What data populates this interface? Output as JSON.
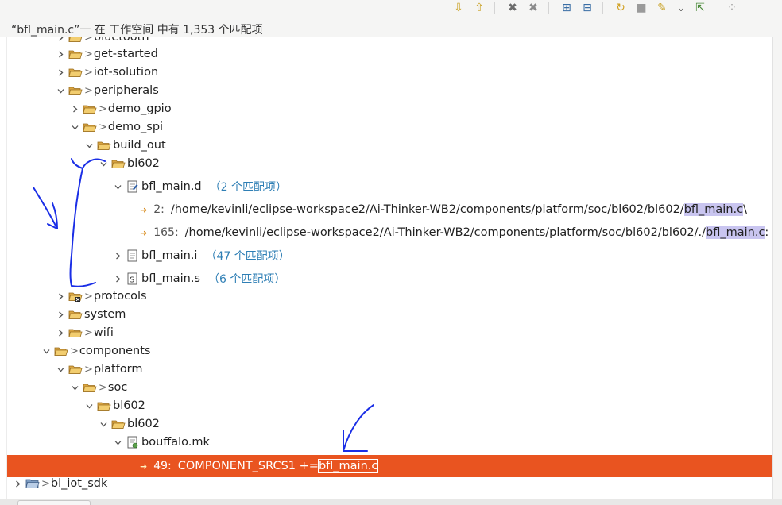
{
  "toolbar": {
    "buttons": [
      {
        "name": "show-next-match-button",
        "glyph": "⇩",
        "color": "#c9a227"
      },
      {
        "name": "show-previous-match-button",
        "glyph": "⇧",
        "color": "#c9a227"
      },
      {
        "name": "remove-selected-matches-button",
        "glyph": "✖",
        "color": "#6b6b6b"
      },
      {
        "name": "remove-all-matches-button",
        "glyph": "✖",
        "color": "#8a8a8a"
      },
      {
        "name": "expand-all-button",
        "glyph": "⊞",
        "color": "#3a6ea5"
      },
      {
        "name": "collapse-all-button",
        "glyph": "⊟",
        "color": "#3a6ea5"
      },
      {
        "name": "run-current-search-again-button",
        "glyph": "↻",
        "color": "#d1a020"
      },
      {
        "name": "cancel-current-search-button",
        "glyph": "■",
        "color": "#9a9a9a"
      },
      {
        "name": "show-previous-searches-button",
        "glyph": "✎",
        "color": "#c9a227"
      },
      {
        "name": "history-dropdown-button",
        "glyph": "⌄",
        "color": "#555555"
      },
      {
        "name": "pin-search-view-button",
        "glyph": "⇱",
        "color": "#4a8a3a"
      },
      {
        "name": "view-menu-button",
        "glyph": "⁘",
        "color": "#9a9a9a"
      }
    ]
  },
  "search": {
    "summary": "“bfl_main.c”一 在 工作空间 中有 1,353 个匹配项"
  },
  "tree": {
    "rows": [
      {
        "depth": 3,
        "twisty": "right",
        "icon": "folder",
        "gt": true,
        "label": "bluetooth"
      },
      {
        "depth": 3,
        "twisty": "right",
        "icon": "folder",
        "gt": true,
        "label": "get-started"
      },
      {
        "depth": 3,
        "twisty": "right",
        "icon": "folder",
        "gt": true,
        "label": "iot-solution"
      },
      {
        "depth": 3,
        "twisty": "down",
        "icon": "folder",
        "gt": true,
        "label": "peripherals"
      },
      {
        "depth": 4,
        "twisty": "right",
        "icon": "folder",
        "gt": true,
        "label": "demo_gpio"
      },
      {
        "depth": 4,
        "twisty": "down",
        "icon": "folder",
        "gt": true,
        "label": "demo_spi"
      },
      {
        "depth": 5,
        "twisty": "down",
        "icon": "folder",
        "gt": false,
        "label": "build_out"
      },
      {
        "depth": 6,
        "twisty": "down",
        "icon": "folder",
        "gt": false,
        "label": "bl602"
      },
      {
        "depth": 7,
        "twisty": "down",
        "icon": "file-d",
        "gt": false,
        "label": "bfl_main.d",
        "count": "（2 个匹配项）",
        "tall": true
      },
      {
        "depth": 8,
        "twisty": "none",
        "icon": "match",
        "gt": false,
        "lineno": "2:",
        "prefix": "/home/kevinli/eclipse-workspace2/Ai-Thinker-WB2/components/platform/soc/bl602/bl602/",
        "match": "bfl_main.c",
        "suffix": " \\",
        "tall": true
      },
      {
        "depth": 8,
        "twisty": "none",
        "icon": "match",
        "gt": false,
        "lineno": "165:",
        "prefix": "/home/kevinli/eclipse-workspace2/Ai-Thinker-WB2/components/platform/soc/bl602/bl602/./",
        "match": "bfl_main.c",
        "suffix": ":",
        "tall": true
      },
      {
        "depth": 7,
        "twisty": "right",
        "icon": "file-i",
        "gt": false,
        "label": "bfl_main.i",
        "count": "（47 个匹配项）",
        "tall": true
      },
      {
        "depth": 7,
        "twisty": "right",
        "icon": "file-s",
        "gt": false,
        "label": "bfl_main.s",
        "count": "（6 个匹配项）",
        "tall": true
      },
      {
        "depth": 3,
        "twisty": "right",
        "icon": "folder-x",
        "gt": true,
        "label": "protocols"
      },
      {
        "depth": 3,
        "twisty": "right",
        "icon": "folder",
        "gt": false,
        "label": "system"
      },
      {
        "depth": 3,
        "twisty": "right",
        "icon": "folder",
        "gt": true,
        "label": "wifi"
      },
      {
        "depth": 2,
        "twisty": "down",
        "icon": "folder",
        "gt": true,
        "label": "components"
      },
      {
        "depth": 3,
        "twisty": "down",
        "icon": "folder",
        "gt": true,
        "label": "platform"
      },
      {
        "depth": 4,
        "twisty": "down",
        "icon": "folder",
        "gt": true,
        "label": "soc"
      },
      {
        "depth": 5,
        "twisty": "down",
        "icon": "folder",
        "gt": false,
        "label": "bl602"
      },
      {
        "depth": 6,
        "twisty": "down",
        "icon": "folder",
        "gt": false,
        "label": "bl602"
      },
      {
        "depth": 7,
        "twisty": "down",
        "icon": "file-mk",
        "gt": false,
        "label": "bouffalo.mk"
      },
      {
        "depth": 8,
        "twisty": "none",
        "icon": "match",
        "gt": false,
        "lineno": "49:",
        "prefix": "COMPONENT_SRCS1 += ",
        "match": "bfl_main.c",
        "suffix": "",
        "selected": true,
        "tall": true
      },
      {
        "depth": 0,
        "twisty": "right",
        "icon": "project",
        "gt": true,
        "label": "bl_iot_sdk"
      }
    ]
  },
  "colors": {
    "selection": "#e95420",
    "match_highlight": "#c9c5f0",
    "count_text": "#2f7fb5",
    "annotation_ink": "#1a2ee6"
  }
}
